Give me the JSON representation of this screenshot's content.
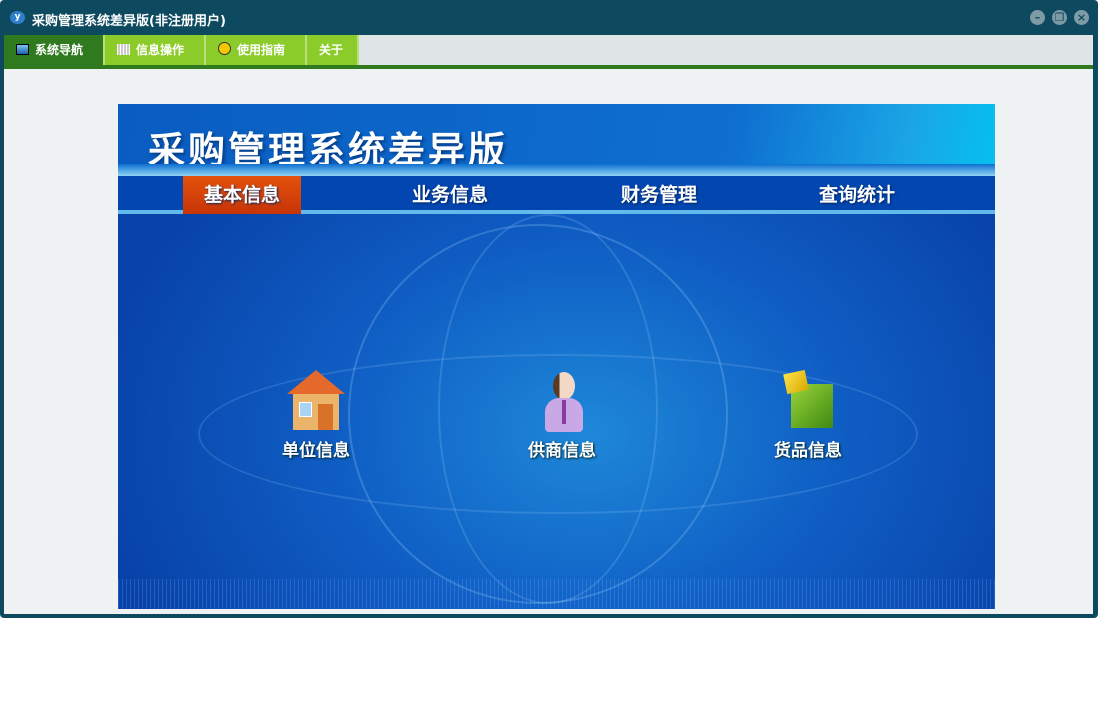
{
  "window": {
    "title": "采购管理系统差异版(非注册用户)",
    "logo_text": "y"
  },
  "toolbar": {
    "tabs": [
      {
        "label": "系统导航"
      },
      {
        "label": "信息操作"
      },
      {
        "label": "使用指南"
      },
      {
        "label": "关于"
      }
    ]
  },
  "banner": {
    "title": "采购管理系统差异版",
    "nav": [
      {
        "label": "基本信息"
      },
      {
        "label": "业务信息"
      },
      {
        "label": "财务管理"
      },
      {
        "label": "查询统计"
      }
    ],
    "modules": [
      {
        "label": "单位信息",
        "icon": "house-icon"
      },
      {
        "label": "供商信息",
        "icon": "person-icon"
      },
      {
        "label": "货品信息",
        "icon": "boxes-icon"
      }
    ]
  },
  "colors": {
    "titlebar": "#0d4a5f",
    "tab_active": "#2f7a1f",
    "tab": "#8ccc2a",
    "nav_active": "#d9430a"
  }
}
